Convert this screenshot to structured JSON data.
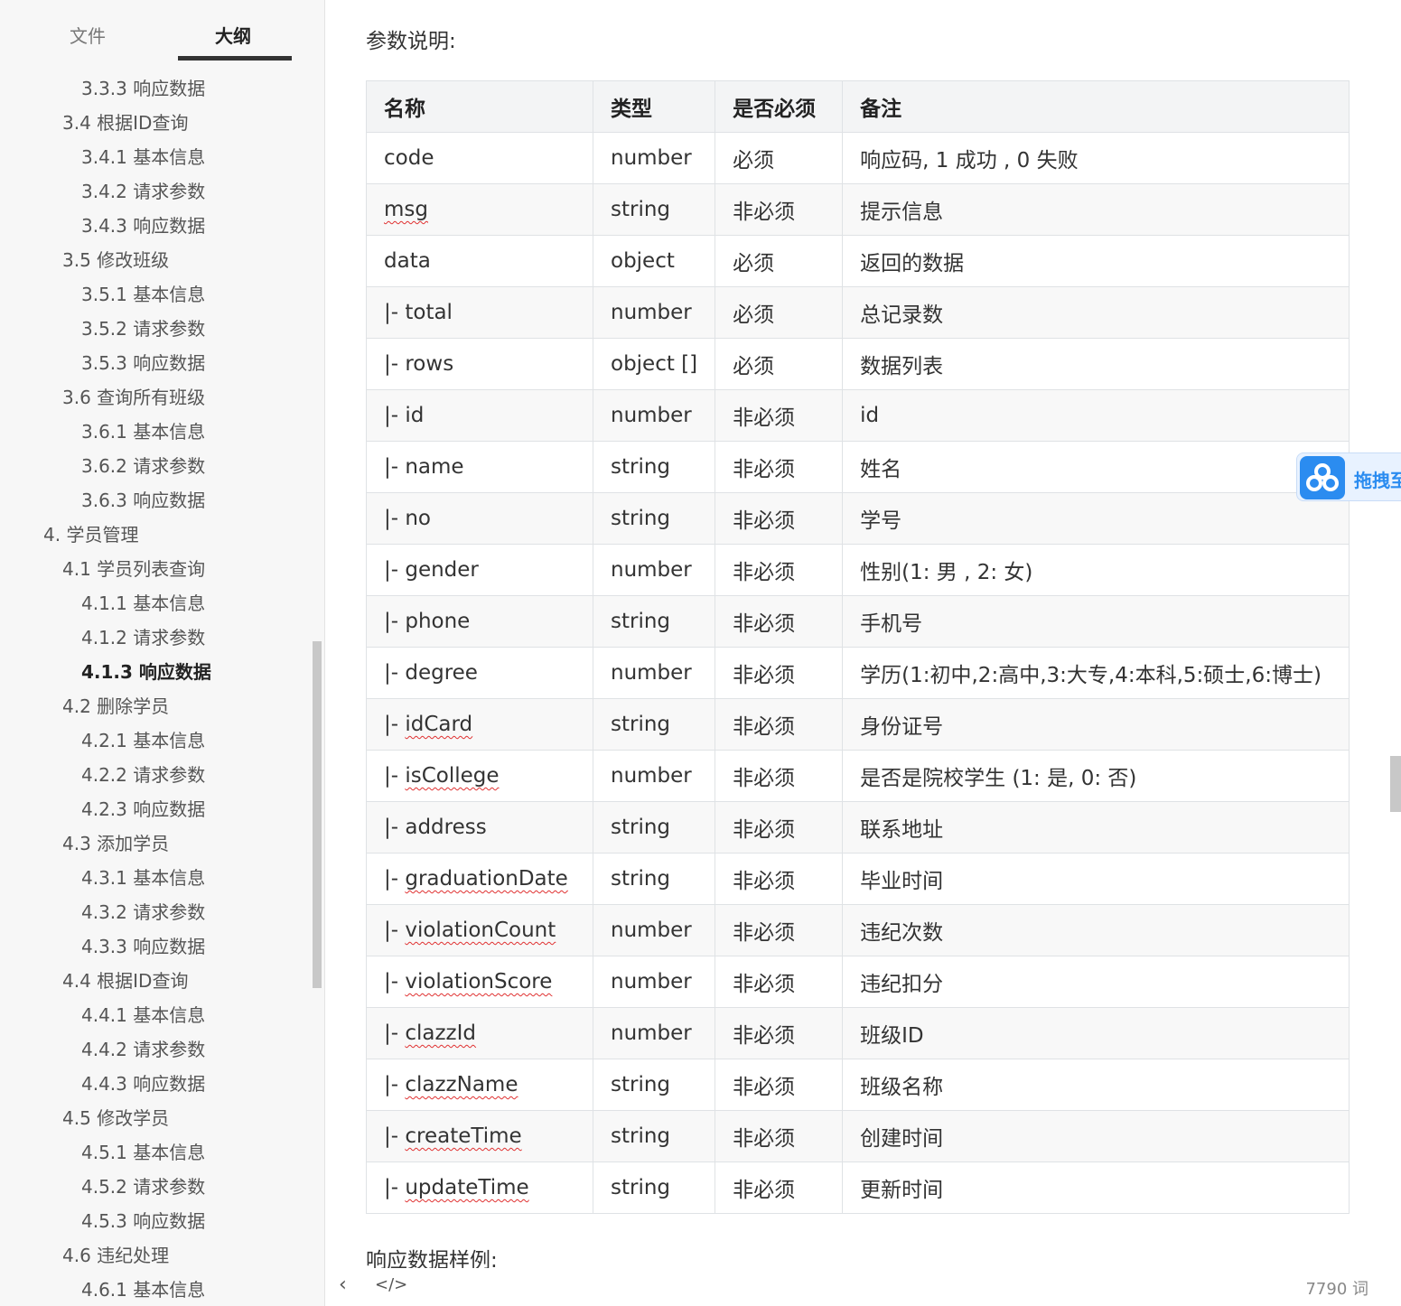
{
  "sidebar": {
    "tabs": {
      "files": "文件",
      "outline": "大纲"
    },
    "items": [
      {
        "label": "3.3.3 响应数据",
        "level": 3
      },
      {
        "label": "3.4 根据ID查询",
        "level": 2
      },
      {
        "label": "3.4.1 基本信息",
        "level": 3
      },
      {
        "label": "3.4.2 请求参数",
        "level": 3
      },
      {
        "label": "3.4.3 响应数据",
        "level": 3
      },
      {
        "label": "3.5 修改班级",
        "level": 2
      },
      {
        "label": "3.5.1 基本信息",
        "level": 3
      },
      {
        "label": "3.5.2 请求参数",
        "level": 3
      },
      {
        "label": "3.5.3 响应数据",
        "level": 3
      },
      {
        "label": "3.6 查询所有班级",
        "level": 2
      },
      {
        "label": "3.6.1 基本信息",
        "level": 3
      },
      {
        "label": "3.6.2 请求参数",
        "level": 3
      },
      {
        "label": "3.6.3 响应数据",
        "level": 3
      },
      {
        "label": "4. 学员管理",
        "level": 1
      },
      {
        "label": "4.1 学员列表查询",
        "level": 2
      },
      {
        "label": "4.1.1 基本信息",
        "level": 3
      },
      {
        "label": "4.1.2 请求参数",
        "level": 3
      },
      {
        "label": "4.1.3 响应数据",
        "level": 3,
        "active": true
      },
      {
        "label": "4.2 删除学员",
        "level": 2
      },
      {
        "label": "4.2.1 基本信息",
        "level": 3
      },
      {
        "label": "4.2.2 请求参数",
        "level": 3
      },
      {
        "label": "4.2.3 响应数据",
        "level": 3
      },
      {
        "label": "4.3 添加学员",
        "level": 2
      },
      {
        "label": "4.3.1 基本信息",
        "level": 3
      },
      {
        "label": "4.3.2 请求参数",
        "level": 3
      },
      {
        "label": "4.3.3 响应数据",
        "level": 3
      },
      {
        "label": "4.4 根据ID查询",
        "level": 2
      },
      {
        "label": "4.4.1 基本信息",
        "level": 3
      },
      {
        "label": "4.4.2 请求参数",
        "level": 3
      },
      {
        "label": "4.4.3 响应数据",
        "level": 3
      },
      {
        "label": "4.5 修改学员",
        "level": 2
      },
      {
        "label": "4.5.1 基本信息",
        "level": 3
      },
      {
        "label": "4.5.2 请求参数",
        "level": 3
      },
      {
        "label": "4.5.3 响应数据",
        "level": 3
      },
      {
        "label": "4.6 违纪处理",
        "level": 2
      },
      {
        "label": "4.6.1 基本信息",
        "level": 3
      }
    ]
  },
  "main": {
    "param_heading": "参数说明:",
    "table": {
      "headers": [
        "名称",
        "类型",
        "是否必须",
        "备注"
      ],
      "rows": [
        {
          "prefix": "",
          "name": "code",
          "type": "number",
          "required": "必须",
          "note": "响应码, 1 成功 , 0 失败",
          "spell": false
        },
        {
          "prefix": "",
          "name": "msg",
          "type": "string",
          "required": "非必须",
          "note": "提示信息",
          "spell": true
        },
        {
          "prefix": "",
          "name": "data",
          "type": "object",
          "required": "必须",
          "note": "返回的数据",
          "spell": false
        },
        {
          "prefix": "|- ",
          "name": "total",
          "type": "number",
          "required": "必须",
          "note": "总记录数",
          "spell": false
        },
        {
          "prefix": "|- ",
          "name": "rows",
          "type": "object []",
          "required": "必须",
          "note": "数据列表",
          "spell": false
        },
        {
          "prefix": "|- ",
          "name": "id",
          "type": "number",
          "required": "非必须",
          "note": "id",
          "spell": false
        },
        {
          "prefix": "|- ",
          "name": "name",
          "type": "string",
          "required": "非必须",
          "note": "姓名",
          "spell": false
        },
        {
          "prefix": "|- ",
          "name": "no",
          "type": "string",
          "required": "非必须",
          "note": "学号",
          "spell": false
        },
        {
          "prefix": "|- ",
          "name": "gender",
          "type": "number",
          "required": "非必须",
          "note": "性别(1: 男 , 2: 女)",
          "spell": false
        },
        {
          "prefix": "|- ",
          "name": "phone",
          "type": "string",
          "required": "非必须",
          "note": "手机号",
          "spell": false
        },
        {
          "prefix": "|- ",
          "name": "degree",
          "type": "number",
          "required": "非必须",
          "note": "学历(1:初中,2:高中,3:大专,4:本科,5:硕士,6:博士)",
          "spell": false
        },
        {
          "prefix": "|- ",
          "name": "idCard",
          "type": "string",
          "required": "非必须",
          "note": "身份证号",
          "spell": true
        },
        {
          "prefix": "|- ",
          "name": "isCollege",
          "type": "number",
          "required": "非必须",
          "note": "是否是院校学生 (1: 是, 0: 否)",
          "spell": true
        },
        {
          "prefix": "|- ",
          "name": "address",
          "type": "string",
          "required": "非必须",
          "note": "联系地址",
          "spell": false
        },
        {
          "prefix": "|- ",
          "name": "graduationDate",
          "type": "string",
          "required": "非必须",
          "note": "毕业时间",
          "spell": true
        },
        {
          "prefix": "|- ",
          "name": "violationCount",
          "type": "number",
          "required": "非必须",
          "note": "违纪次数",
          "spell": true
        },
        {
          "prefix": "|- ",
          "name": "violationScore",
          "type": "number",
          "required": "非必须",
          "note": "违纪扣分",
          "spell": true
        },
        {
          "prefix": "|- ",
          "name": "clazzId",
          "type": "number",
          "required": "非必须",
          "note": "班级ID",
          "spell": true
        },
        {
          "prefix": "|- ",
          "name": "clazzName",
          "type": "string",
          "required": "非必须",
          "note": "班级名称",
          "spell": true
        },
        {
          "prefix": "|- ",
          "name": "createTime",
          "type": "string",
          "required": "非必须",
          "note": "创建时间",
          "spell": true
        },
        {
          "prefix": "|- ",
          "name": "updateTime",
          "type": "string",
          "required": "非必须",
          "note": "更新时间",
          "spell": true
        }
      ]
    },
    "sample_heading": "响应数据样例:"
  },
  "bottom_bar": {
    "prev_icon": "‹",
    "code_icon": "</>",
    "word_count": "7790 词"
  },
  "float_widget": {
    "label": "拖拽至",
    "icon": "cloud-icon",
    "color": "#2b8cf0"
  }
}
